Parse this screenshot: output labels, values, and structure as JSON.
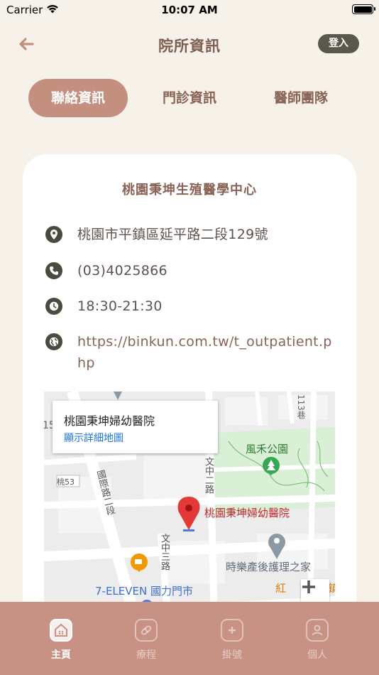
{
  "status_bar": {
    "carrier": "Carrier",
    "time": "10:07 AM"
  },
  "nav": {
    "title": "院所資訊",
    "login_label": "登入"
  },
  "tabs": [
    {
      "label": "聯絡資訊",
      "active": true
    },
    {
      "label": "門診資訊",
      "active": false
    },
    {
      "label": "醫師團隊",
      "active": false
    }
  ],
  "clinic": {
    "name": "桃園秉坤生殖醫學中心",
    "address": "桃園市平鎮區延平路二段129號",
    "phone": "(03)4025866",
    "hours": "18:30-21:30",
    "website": "https://binkun.com.tw/t_outpatient.php"
  },
  "map": {
    "popup_title": "桃園秉坤婦幼醫院",
    "popup_link": "顯示詳細地圖",
    "pin_label": "桃園秉坤婦幼醫院",
    "park_label": "風禾公園",
    "care_label": "時樂產後護理之家",
    "store_label": "7-ELEVEN 國力門市",
    "road_label_1": "國際路二段",
    "road_label_2": "文中二路",
    "road_label_3": "文中三路",
    "route_badge": "桃53",
    "lane_label": "113巷",
    "partial_label_left": "15",
    "partial_label_right": "紅",
    "partial_label_right2": "鎮",
    "zoom_label": "+"
  },
  "tabbar": [
    {
      "label": "主頁",
      "icon": "home-icon",
      "active": true
    },
    {
      "label": "療程",
      "icon": "pill-icon",
      "active": false
    },
    {
      "label": "掛號",
      "icon": "medical-plus-icon",
      "active": false
    },
    {
      "label": "個人",
      "icon": "person-icon",
      "active": false
    }
  ],
  "colors": {
    "background": "#f6f1e9",
    "accent": "#c58f80",
    "title_brown": "#8a6357",
    "tabbar": "#c79184",
    "pin_red": "#e53935"
  }
}
